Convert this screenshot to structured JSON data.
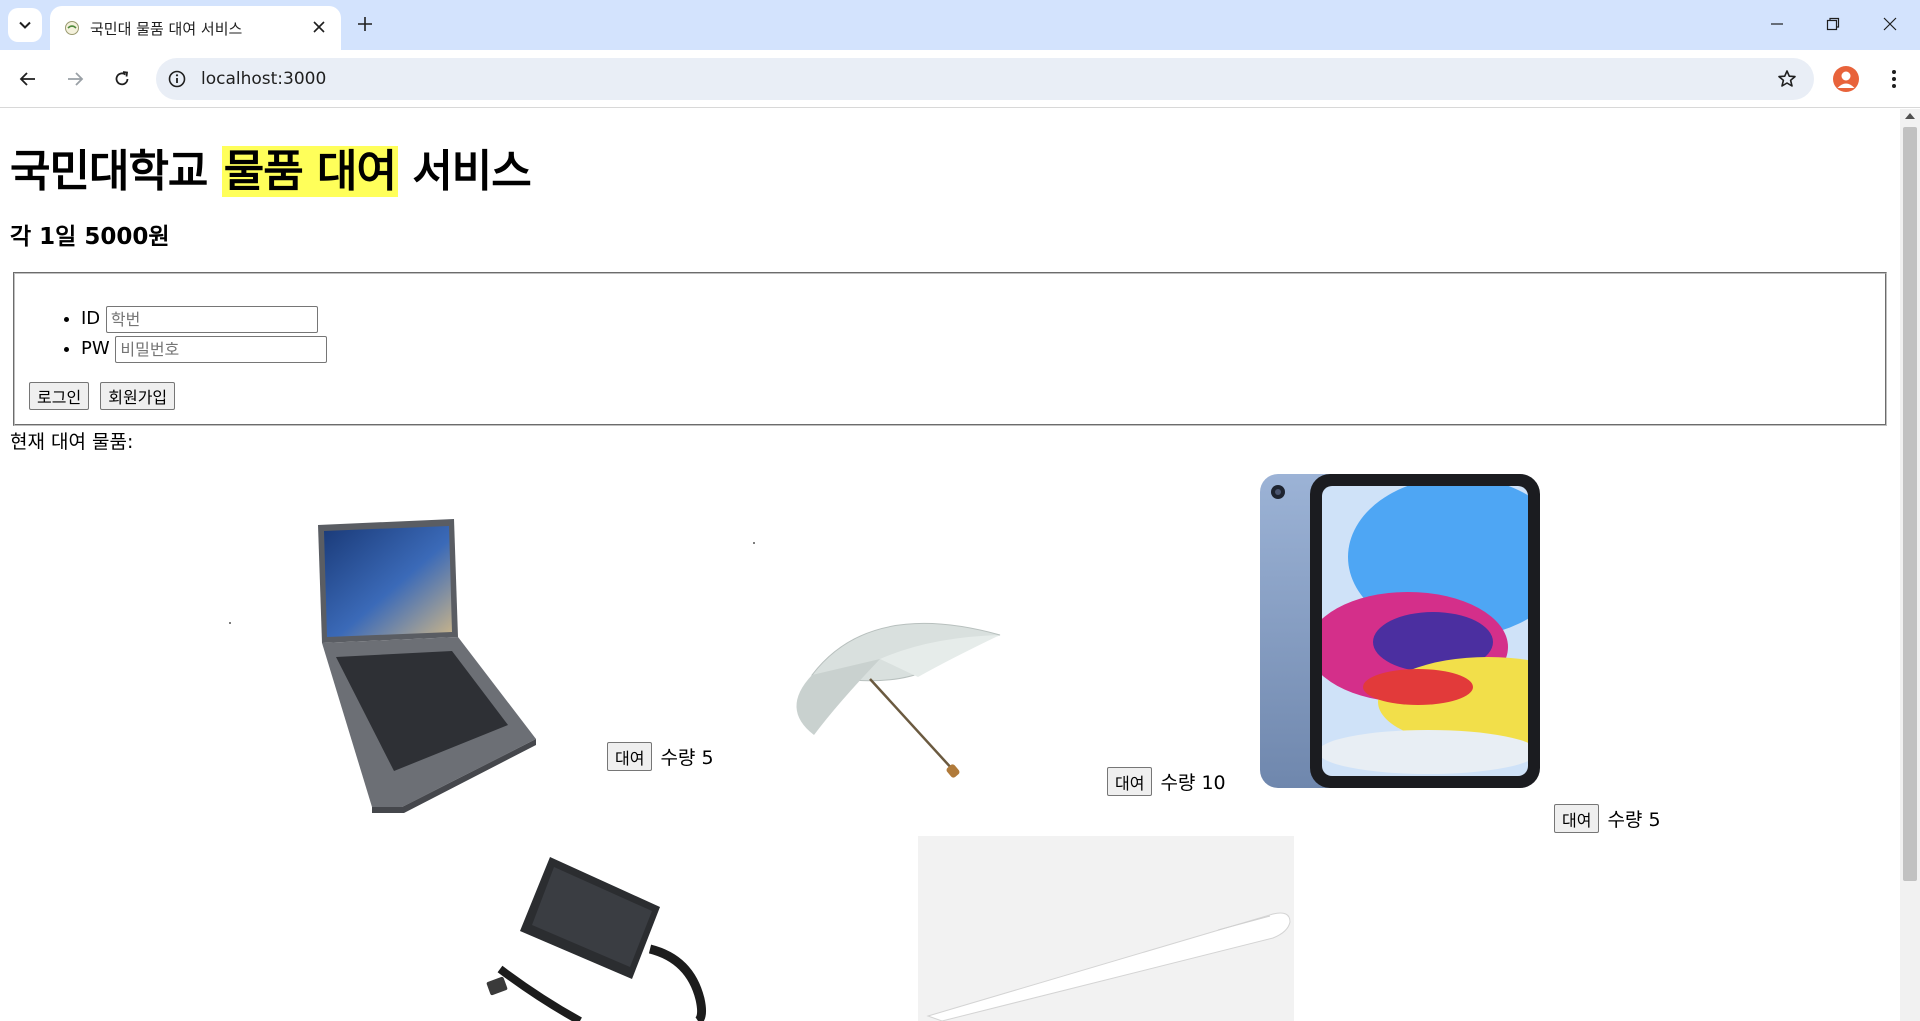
{
  "browser": {
    "tab_title": "국민대 물품 대여 서비스",
    "url": "localhost:3000"
  },
  "page": {
    "title_before": "국민대학교",
    "title_highlight": "물품 대여",
    "title_after": "서비스",
    "subtitle": "각 1일 5000원",
    "login": {
      "id_label": "ID",
      "id_placeholder": "학번",
      "pw_label": "PW",
      "pw_placeholder": "비밀번호",
      "login_button": "로그인",
      "signup_button": "회원가입"
    },
    "current_label": "현재 대여 물품:",
    "items": [
      {
        "name": "laptop",
        "rent_label": "대여",
        "quantity_text": "수량 5"
      },
      {
        "name": "umbrella",
        "rent_label": "대여",
        "quantity_text": "수량 10"
      },
      {
        "name": "tablet",
        "rent_label": "대여",
        "quantity_text": "수량 5"
      },
      {
        "name": "charger",
        "rent_label": "",
        "quantity_text": ""
      },
      {
        "name": "pencil",
        "rent_label": "",
        "quantity_text": ""
      }
    ]
  },
  "colors": {
    "highlight": "#ffff5a",
    "tabstrip": "#d3e3fd",
    "omnibox": "#e9eef6",
    "avatar": "#e8633b"
  }
}
